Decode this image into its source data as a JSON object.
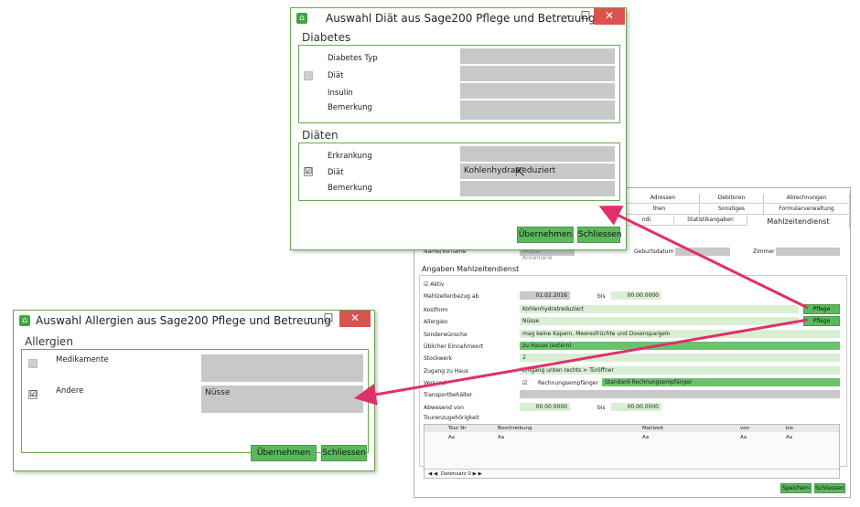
{
  "diat_dialog": {
    "title": "Auswahl Diät aus Sage200 Pflege und Betreuung",
    "diabetes_section": "Diabetes",
    "diabetes_typ_label": "Diabetes Typ",
    "diat_label": "Diät",
    "insulin_label": "Insulin",
    "bemerkung_label": "Bemerkung",
    "diaten_section": "Diäten",
    "erkrankung_label": "Erkrankung",
    "diat2_label": "Diät",
    "diat2_value": "Kohlenhydratreduziert",
    "bemerkung2_label": "Bemerkung",
    "ubernehmen": "Übernehmen",
    "schliessen": "Schliessen",
    "check_mark": "☑"
  },
  "allergien_dialog": {
    "title": "Auswahl Allergien aus Sage200 Pflege und Betreuung",
    "section": "Allergien",
    "medikamente_label": "Medikamente",
    "andere_label": "Andere",
    "andere_value": "Nüsse",
    "ubernehmen": "Übernehmen",
    "schliessen": "Schliessen",
    "check_mark": "☑"
  },
  "window_buttons": {
    "minimize": "–",
    "maximize": "☐",
    "close": "✕"
  },
  "main_form": {
    "tabs_row1": [
      "Adressen",
      "Debitoren",
      "Abrechnungen"
    ],
    "tabs_row2": [
      "then",
      "Sonstiges",
      "Formularverwaltung"
    ],
    "tabs_row3": [
      "ndi",
      "Statistikangaben",
      "Mahlzeitendienst"
    ],
    "name_label": "Name/Vorname",
    "name_value": "Muster Annemarie",
    "geburtsdatum_label": "Geburtsdatum",
    "zimmer_label": "Zimmer",
    "section": "Angaben Mahlzeitendienst",
    "aktiv_label": "Aktiv",
    "mahlzeitenbezug_label": "Mahlzeitenbezug ab",
    "mahlzeitenbezug_value": "01.02.2016",
    "bis_label": "bis",
    "bis_value": "00.00.0000",
    "kostform_label": "Kostform",
    "kostform_value": "Kohlenhydratreduziert",
    "allergien_label": "Allergien",
    "allergien_value": "Nüsse",
    "pflege_btn": "Pflege",
    "sonderwunsche_label": "Sonderwünsche",
    "sonderwunsche_value": "mag keine Kapern, Meeresfrüchte und Dosenspargeln",
    "einnahmeort_label": "Üblicher Einnahmeort",
    "einnahmeort_value": "zu Hause (extern)",
    "stockwerk_label": "Stockwerk",
    "stockwerk_value": "2",
    "zugang_label": "Zugang zu Haus",
    "zugang_value": "Eingang unten rechts > Türöffner",
    "versand_label": "Versand",
    "rechnungsempfanger_label": "Rechnungsempfänger",
    "rechnungsempfanger_value": "Standard-Rechnungsempfänger",
    "transportbehalter_label": "Transportbehälter",
    "abwesend_label": "Abwesend von",
    "abwesend_von": "00.00.0000",
    "abwesend_bis": "00.00.0000",
    "tourenzugehorigkeit_label": "Tourenzugehörigkeit",
    "grid_headers": [
      "Tour Nr",
      "Beschreibung",
      "Mahlzeit",
      "von",
      "bis"
    ],
    "grid_filter": "Aa",
    "datensatz_label": "Datensatz",
    "datensatz_value": "0",
    "speichern": "Speichern",
    "schliessen": "Schliessen"
  },
  "colors": {
    "accent_green": "#5cb85c",
    "border_green": "#6aa84f",
    "arrow_pink": "#e0306a",
    "close_red": "#d9534f"
  }
}
